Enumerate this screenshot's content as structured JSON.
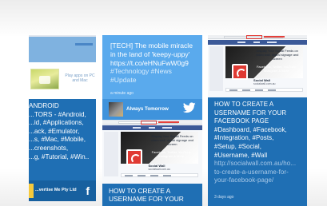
{
  "left_column": {
    "top_card": {
      "play_text": "Play apps on PC and Mac"
    },
    "bottom_card": {
      "lines": [
        "ANDROID",
        "...TORS - #Android,",
        "...id, #Applications,",
        "...ack, #Emulator,",
        "...s, #Mac, #Mobile,",
        "...creenshots,",
        "...g, #Tutorial, #Win.."
      ],
      "author": "...vertise Me Pty Ltd",
      "social_icon": "facebook-icon"
    }
  },
  "middle_column": {
    "tweet_card": {
      "text_line1": "[TECH] The mobile miracle",
      "text_line2": "in the land of 'keepy-uppy'",
      "link": "https://t.co/eHNuFwW0g9",
      "tags_line1": "#Technology #News",
      "tags_line2": "#Update",
      "time": "a minute ago",
      "author": "Always Tomorrow",
      "social_icon": "twitter-icon"
    },
    "screenshot_card": {
      "cover_text": "Display Your Social Feeds on video wall, digital signage and screen",
      "cover_sub": "Facebook, Twitter, YouTube Instagram & More",
      "page_name": "Social Wall",
      "page_url": "socialwall.com.au",
      "caption_line1": "HOW TO CREATE A",
      "caption_line2": "USERNAME FOR YOUR"
    }
  },
  "right_column": {
    "post_card": {
      "cover_text": "Display Your Social Feeds on video wall, digital signage and screen",
      "cover_sub": "Facebook, Twitter, YouTube Instagram & More",
      "page_name": "Social Wall",
      "page_url": "socialwall.com.au",
      "title_lines": [
        "HOW TO CREATE A",
        "USERNAME FOR YOUR",
        "FACEBOOK PAGE"
      ],
      "tag_lines": [
        "#Dashboard, #Facebook,",
        "#Integration, #Posts,",
        "#Setup, #Social,",
        "#Username, #Wall"
      ],
      "link_lines": [
        "http://socialwall.com.au/ho...",
        "to-create-a-username-for-",
        "your-facebook-page/"
      ],
      "time": "3 days ago"
    }
  },
  "colors": {
    "twitter_blue": "#5aaaed",
    "facebook_blue": "#1f6fb4",
    "social_wall_red": "#e03a33"
  }
}
